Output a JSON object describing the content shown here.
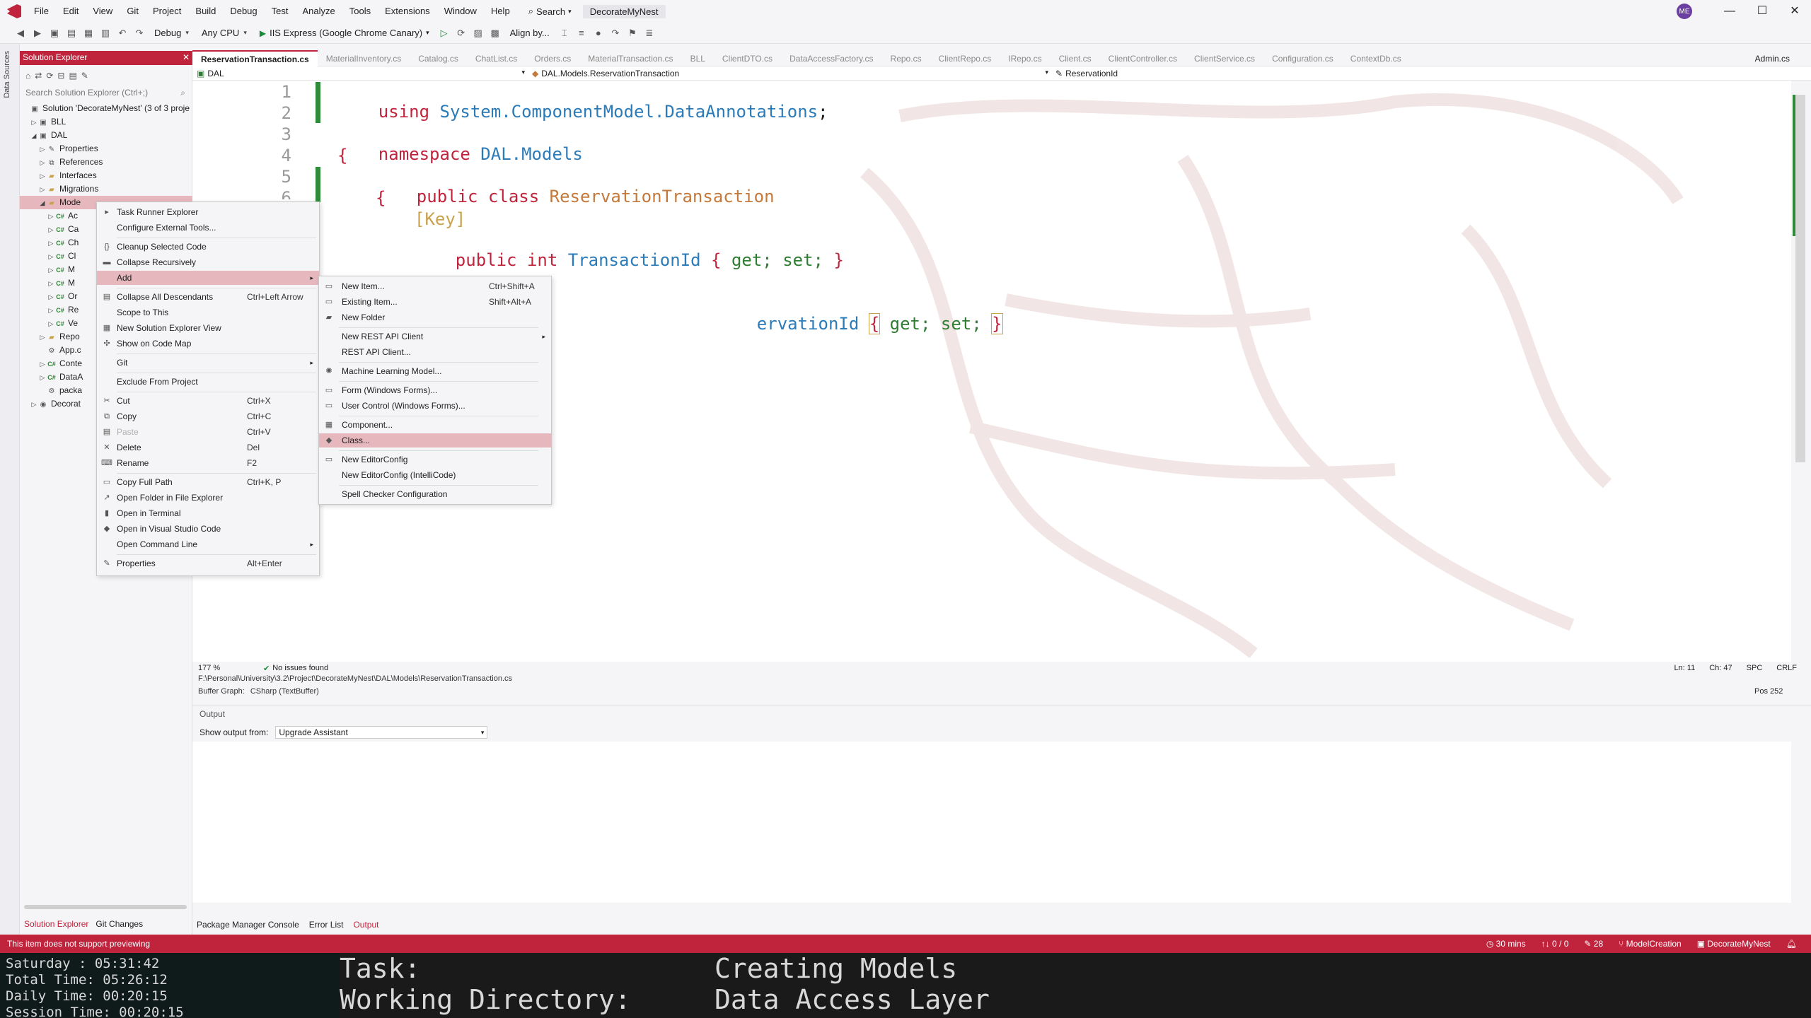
{
  "menubar": {
    "items": [
      "File",
      "Edit",
      "View",
      "Git",
      "Project",
      "Build",
      "Debug",
      "Test",
      "Analyze",
      "Tools",
      "Extensions",
      "Window",
      "Help"
    ],
    "search_label": "Search",
    "solution_badge": "DecorateMyNest",
    "avatar_initials": "ME"
  },
  "toolbar": {
    "config": "Debug",
    "platform": "Any CPU",
    "run_target": "IIS Express (Google Chrome Canary)",
    "align_label": "Align by..."
  },
  "left_strip": {
    "label": "Data Sources"
  },
  "solution_explorer": {
    "title": "Solution Explorer",
    "search_placeholder": "Search Solution Explorer (Ctrl+;)",
    "tree": [
      {
        "label": "Solution 'DecorateMyNest' (3 of 3 proje",
        "indent": 0,
        "arrow": "",
        "icon": "solution-icon"
      },
      {
        "label": "BLL",
        "indent": 1,
        "arrow": "▷",
        "icon": "project-icon"
      },
      {
        "label": "DAL",
        "indent": 1,
        "arrow": "◢",
        "icon": "project-icon"
      },
      {
        "label": "Properties",
        "indent": 2,
        "arrow": "▷",
        "icon": "wrench-icon"
      },
      {
        "label": "References",
        "indent": 2,
        "arrow": "▷",
        "icon": "references-icon"
      },
      {
        "label": "Interfaces",
        "indent": 2,
        "arrow": "▷",
        "icon": "folder-icon"
      },
      {
        "label": "Migrations",
        "indent": 2,
        "arrow": "▷",
        "icon": "folder-icon"
      },
      {
        "label": "Mode",
        "indent": 2,
        "arrow": "◢",
        "icon": "folder-icon",
        "selected": true
      },
      {
        "label": "Ac",
        "indent": 3,
        "arrow": "▷",
        "icon": "cs-icon"
      },
      {
        "label": "Ca",
        "indent": 3,
        "arrow": "▷",
        "icon": "cs-icon"
      },
      {
        "label": "Ch",
        "indent": 3,
        "arrow": "▷",
        "icon": "cs-icon"
      },
      {
        "label": "Cl",
        "indent": 3,
        "arrow": "▷",
        "icon": "cs-icon"
      },
      {
        "label": "M",
        "indent": 3,
        "arrow": "▷",
        "icon": "cs-icon"
      },
      {
        "label": "M",
        "indent": 3,
        "arrow": "▷",
        "icon": "cs-icon"
      },
      {
        "label": "Or",
        "indent": 3,
        "arrow": "▷",
        "icon": "cs-icon"
      },
      {
        "label": "Re",
        "indent": 3,
        "arrow": "▷",
        "icon": "cs-icon"
      },
      {
        "label": "Ve",
        "indent": 3,
        "arrow": "▷",
        "icon": "cs-icon"
      },
      {
        "label": "Repo",
        "indent": 2,
        "arrow": "▷",
        "icon": "folder-icon"
      },
      {
        "label": "App.c",
        "indent": 2,
        "arrow": "",
        "icon": "config-icon"
      },
      {
        "label": "Conte",
        "indent": 2,
        "arrow": "▷",
        "icon": "cs-icon"
      },
      {
        "label": "DataA",
        "indent": 2,
        "arrow": "▷",
        "icon": "cs-icon"
      },
      {
        "label": "packa",
        "indent": 2,
        "arrow": "",
        "icon": "config-icon"
      },
      {
        "label": "Decorat",
        "indent": 1,
        "arrow": "▷",
        "icon": "web-project-icon"
      }
    ],
    "bottom_tabs": [
      "Solution Explorer",
      "Git Changes"
    ]
  },
  "doc_tabs": {
    "tabs": [
      "ReservationTransaction.cs",
      "MaterialInventory.cs",
      "Catalog.cs",
      "ChatList.cs",
      "Orders.cs",
      "MaterialTransaction.cs",
      "BLL",
      "ClientDTO.cs",
      "DataAccessFactory.cs",
      "Repo.cs",
      "ClientRepo.cs",
      "IRepo.cs",
      "Client.cs",
      "ClientController.cs",
      "ClientService.cs",
      "Configuration.cs",
      "ContextDb.cs"
    ],
    "pinned": "Admin.cs"
  },
  "nav_bar": {
    "project": "DAL",
    "type": "DAL.Models.ReservationTransaction",
    "member": "ReservationId"
  },
  "editor": {
    "line_numbers": [
      "1",
      "2",
      "3",
      "4",
      "5",
      "6"
    ],
    "l1_kw": "using",
    "l1_ns": "System.ComponentModel.DataAnnotations",
    "l1_end": ";",
    "l3_kw": "namespace",
    "l3_ns": "DAL.Models",
    "l4": "{",
    "l5_kw": "public class",
    "l5_cls": "ReservationTransaction",
    "l6": "{",
    "l7_attr": "[Key]",
    "l8_kw": "public int",
    "l8_prop": "TransactionId",
    "l8_open": "{",
    "l8_acc": "get; set;",
    "l8_close": "}",
    "l10_prop": "ervationId",
    "l10_open": "{",
    "l10_acc": "get; set;",
    "l10_close": "}"
  },
  "editor_status": {
    "zoom": "177 %",
    "issues": "No issues found",
    "line": "Ln: 11",
    "col": "Ch: 47",
    "spc": "SPC",
    "eol": "CRLF",
    "path": "F:\\Personal\\University\\3.2\\Project\\DecorateMyNest\\DAL\\Models\\ReservationTransaction.cs",
    "buffer_label": "Buffer Graph:",
    "buffer_value": "CSharp (TextBuffer)",
    "pos": "Pos 252"
  },
  "output": {
    "title": "Output",
    "from_label": "Show output from:",
    "from_value": "Upgrade Assistant",
    "bottom_tabs": [
      "Package Manager Console",
      "Error List",
      "Output"
    ]
  },
  "status_bar": {
    "message": "This item does not support previewing",
    "time": "30 mins",
    "counts": "0 / 0",
    "edits": "28",
    "branch": "ModelCreation",
    "repo": "DecorateMyNest"
  },
  "terminal": {
    "rows": [
      {
        "label": "Saturday  :",
        "value": "05:31:42"
      },
      {
        "label": "Total Time:",
        "value": "05:26:12"
      },
      {
        "label": "Daily Time:",
        "value": "00:20:15"
      },
      {
        "label": "Session Time:",
        "value": "00:20:15"
      }
    ],
    "task_label": "Task:",
    "task_value": "Creating Models",
    "wd_label": "Working Directory:",
    "wd_value": "Data Access Layer"
  },
  "context_menu": {
    "items": [
      {
        "label": "Task Runner Explorer",
        "short": "",
        "icon": "task-runner-icon"
      },
      {
        "label": "Configure External Tools...",
        "short": "",
        "icon": ""
      },
      {
        "label": "Cleanup Selected Code",
        "short": "",
        "icon": "braces-icon"
      },
      {
        "label": "Collapse Recursively",
        "short": "",
        "icon": "collapse-icon"
      },
      {
        "label": "Add",
        "short": "",
        "icon": "",
        "arrow": true,
        "hl": true
      },
      {
        "label": "Collapse All Descendants",
        "short": "Ctrl+Left Arrow",
        "icon": "collapse-all-icon"
      },
      {
        "label": "Scope to This",
        "short": "",
        "icon": ""
      },
      {
        "label": "New Solution Explorer View",
        "short": "",
        "icon": "new-view-icon"
      },
      {
        "label": "Show on Code Map",
        "short": "",
        "icon": "code-map-icon"
      },
      {
        "label": "Git",
        "short": "",
        "icon": "",
        "arrow": true
      },
      {
        "label": "Exclude From Project",
        "short": "",
        "icon": ""
      },
      {
        "label": "Cut",
        "short": "Ctrl+X",
        "icon": "cut-icon"
      },
      {
        "label": "Copy",
        "short": "Ctrl+C",
        "icon": "copy-icon"
      },
      {
        "label": "Paste",
        "short": "Ctrl+V",
        "icon": "paste-icon",
        "disabled": true
      },
      {
        "label": "Delete",
        "short": "Del",
        "icon": "delete-icon"
      },
      {
        "label": "Rename",
        "short": "F2",
        "icon": "rename-icon"
      },
      {
        "label": "Copy Full Path",
        "short": "Ctrl+K, P",
        "icon": "copy-path-icon"
      },
      {
        "label": "Open Folder in File Explorer",
        "short": "",
        "icon": "open-folder-icon"
      },
      {
        "label": "Open in Terminal",
        "short": "",
        "icon": "terminal-icon"
      },
      {
        "label": "Open in Visual Studio Code",
        "short": "",
        "icon": "vscode-icon"
      },
      {
        "label": "Open Command Line",
        "short": "",
        "icon": "",
        "arrow": true
      },
      {
        "label": "Properties",
        "short": "Alt+Enter",
        "icon": "wrench-icon"
      }
    ]
  },
  "add_submenu": {
    "items": [
      {
        "label": "New Item...",
        "short": "Ctrl+Shift+A",
        "icon": "new-item-icon"
      },
      {
        "label": "Existing Item...",
        "short": "Shift+Alt+A",
        "icon": "existing-item-icon"
      },
      {
        "label": "New Folder",
        "short": "",
        "icon": "folder-icon"
      },
      {
        "label": "New REST API Client",
        "short": "",
        "icon": "",
        "arrow": true
      },
      {
        "label": "REST API Client...",
        "short": "",
        "icon": ""
      },
      {
        "label": "Machine Learning Model...",
        "short": "",
        "icon": "ml-icon"
      },
      {
        "label": "Form (Windows Forms)...",
        "short": "",
        "icon": "form-icon"
      },
      {
        "label": "User Control (Windows Forms)...",
        "short": "",
        "icon": "user-control-icon"
      },
      {
        "label": "Component...",
        "short": "",
        "icon": "component-icon"
      },
      {
        "label": "Class...",
        "short": "",
        "icon": "class-icon",
        "hl": true
      },
      {
        "label": "New EditorConfig",
        "short": "",
        "icon": "editorconfig-icon"
      },
      {
        "label": "New EditorConfig (IntelliCode)",
        "short": "",
        "icon": ""
      },
      {
        "label": "Spell Checker Configuration",
        "short": "",
        "icon": ""
      }
    ]
  },
  "colors": {
    "accent": "#c0243d",
    "highlight": "#e6b7bd",
    "change_bar": "#2e8b3a"
  }
}
